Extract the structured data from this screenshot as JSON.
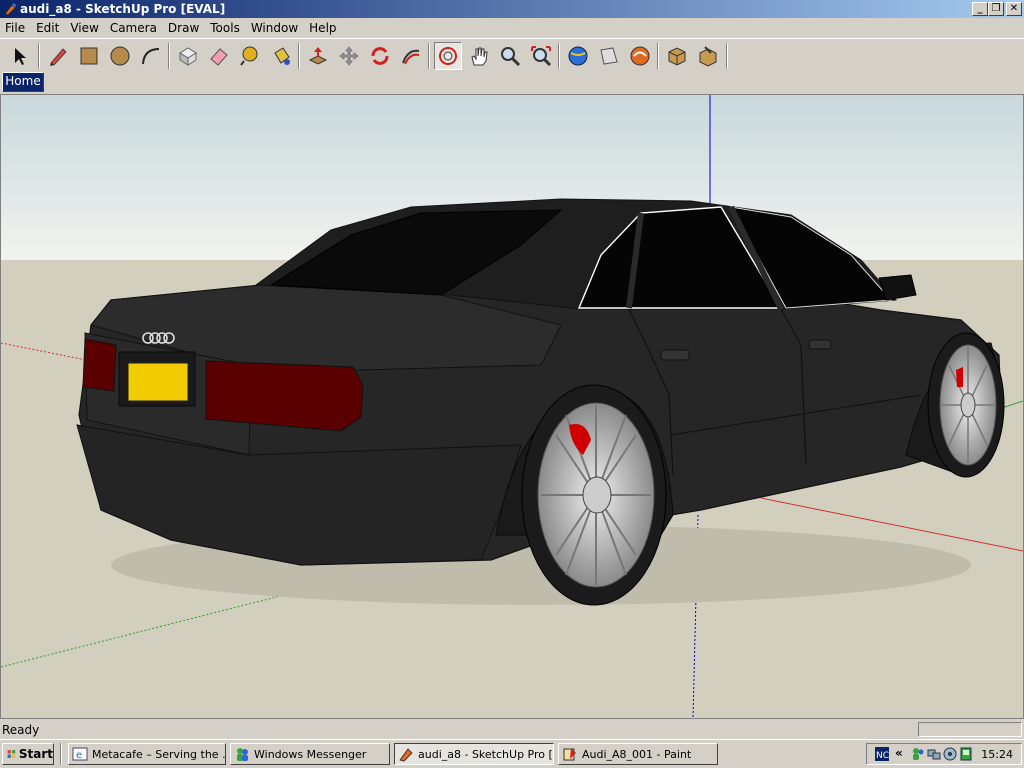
{
  "window": {
    "title": "audi_a8 - SketchUp Pro [EVAL]"
  },
  "menu": [
    "File",
    "Edit",
    "View",
    "Camera",
    "Draw",
    "Tools",
    "Window",
    "Help"
  ],
  "toolbar": {
    "tools": [
      "select-tool",
      "pencil-tool",
      "rectangle-tool",
      "circle-tool",
      "arc-tool",
      "make-component-tool",
      "eraser-tool",
      "tape-measure-tool",
      "paint-bucket-tool",
      "push-pull-tool",
      "move-tool",
      "rotate-tool",
      "follow-me-tool",
      "orbit-tool",
      "pan-tool",
      "zoom-tool",
      "zoom-extents-tool",
      "get-models-tool",
      "share-model-tool",
      "3d-warehouse-tool",
      "components-tool",
      "materials-tool"
    ],
    "active_tool": "orbit-tool"
  },
  "scenes": {
    "tabs": [
      "Home"
    ]
  },
  "status": {
    "text": "Ready"
  },
  "taskbar": {
    "start_label": "Start",
    "tasks": [
      {
        "label": "Metacafe – Serving the ...",
        "icon": "ie-icon",
        "active": false
      },
      {
        "label": "Windows Messenger",
        "icon": "messenger-icon",
        "active": false
      },
      {
        "label": "audi_a8 - SketchUp Pro [...",
        "icon": "sketchup-icon",
        "active": true
      },
      {
        "label": "Audi_A8_001 - Paint",
        "icon": "paint-icon",
        "active": false
      }
    ],
    "clock": "15:24"
  },
  "colors": {
    "title_start": "#0a246a",
    "title_end": "#a6caf0",
    "sky": "#d9e4e6",
    "ground": "#d3cfbf",
    "car_body": "#262626",
    "plate": "#f3cc00",
    "taillight": "#5a0000",
    "brake_caliper": "#d00000"
  }
}
